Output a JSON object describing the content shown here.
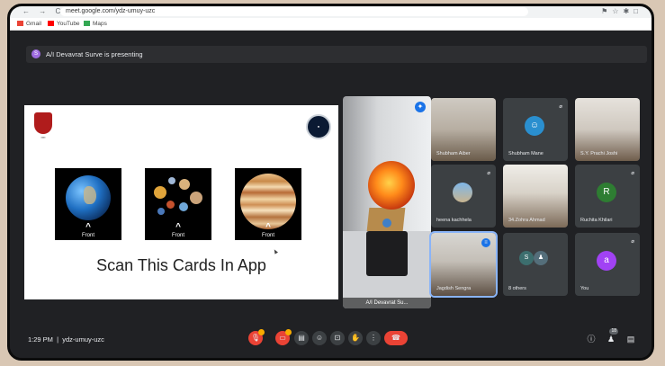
{
  "browser": {
    "url": "meet.google.com/ydz-umuy-uzc",
    "bookmarks": [
      "Gmail",
      "YouTube",
      "Maps"
    ]
  },
  "banner": {
    "avatar_letter": "S",
    "text": "A/I Devavrat Surve is presenting"
  },
  "slide": {
    "cards": [
      {
        "name": "earth",
        "label": "Front"
      },
      {
        "name": "solar-system",
        "label": "Front"
      },
      {
        "name": "jupiter",
        "label": "Front"
      }
    ],
    "caption": "Scan This Cards In App"
  },
  "presenter_tile": {
    "name": "A/I Devavrat Su..."
  },
  "participants": [
    {
      "name": "Shubham Aiber",
      "type": "video"
    },
    {
      "name": "Shubham Mane",
      "type": "video"
    },
    {
      "name": "S.Y. Prachi Joshi",
      "type": "video"
    },
    {
      "name": "heena kachhela",
      "type": "video"
    },
    {
      "name": "34.Zohra Ahmad",
      "type": "video"
    },
    {
      "name": "Ruchita Khilari",
      "type": "avatar",
      "letter": "R",
      "color": "#2e7d32"
    },
    {
      "name": "Jagdish Sengra",
      "type": "video"
    },
    {
      "name": "8 others",
      "type": "others"
    },
    {
      "name": "You",
      "type": "avatar",
      "letter": "a",
      "color": "#a142f4"
    }
  ],
  "bottom": {
    "time": "1:29 PM",
    "meeting_code": "ydz-umuy-uzc",
    "people_count": "18"
  },
  "colors": {
    "meet_bg": "#202124",
    "tile_bg": "#3c4043",
    "end_call": "#ea4335",
    "accent": "#1a73e8"
  }
}
